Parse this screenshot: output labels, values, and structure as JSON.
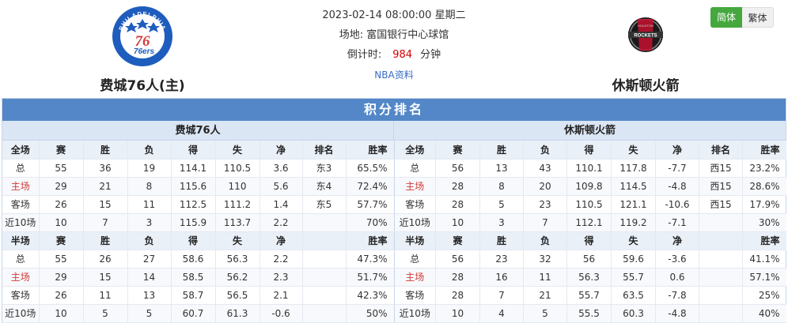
{
  "match": {
    "datetime": "2023-02-14 08:00:00",
    "weekday": "星期二",
    "venue_label": "场地:",
    "venue": "富国银行中心球馆",
    "countdown_label": "倒计时:",
    "countdown_value": "984",
    "countdown_unit": "分钟",
    "nba_link": "NBA资料"
  },
  "home_team": {
    "name": "费城76人(主)",
    "short_name": "费城76人",
    "logo_text": "76ers",
    "logo_ring_text": "PHILADELPHIA"
  },
  "away_team": {
    "name": "休斯顿火箭",
    "short_name": "休斯顿火箭",
    "logo_text": "ROCKETS",
    "logo_ring_text": "HOUSTON"
  },
  "lang": {
    "simplified": "简体",
    "traditional": "繁体"
  },
  "standings": {
    "title": "积分排名",
    "full_header": [
      "全场",
      "赛",
      "胜",
      "负",
      "得",
      "失",
      "净",
      "排名",
      "胜率"
    ],
    "half_header": [
      "半场",
      "赛",
      "胜",
      "负",
      "得",
      "失",
      "净",
      "",
      "胜率"
    ],
    "home": {
      "full": [
        [
          "总",
          "55",
          "36",
          "19",
          "114.1",
          "110.5",
          "3.6",
          "东3",
          "65.5%"
        ],
        [
          "主场",
          "29",
          "21",
          "8",
          "115.6",
          "110",
          "5.6",
          "东4",
          "72.4%"
        ],
        [
          "客场",
          "26",
          "15",
          "11",
          "112.5",
          "111.2",
          "1.4",
          "东5",
          "57.7%"
        ],
        [
          "近10场",
          "10",
          "7",
          "3",
          "115.9",
          "113.7",
          "2.2",
          "",
          "70%"
        ]
      ],
      "half": [
        [
          "总",
          "55",
          "26",
          "27",
          "58.6",
          "56.3",
          "2.2",
          "",
          "47.3%"
        ],
        [
          "主场",
          "29",
          "15",
          "14",
          "58.5",
          "56.2",
          "2.3",
          "",
          "51.7%"
        ],
        [
          "客场",
          "26",
          "11",
          "13",
          "58.7",
          "56.5",
          "2.1",
          "",
          "42.3%"
        ],
        [
          "近10场",
          "10",
          "5",
          "5",
          "60.7",
          "61.3",
          "-0.6",
          "",
          "50%"
        ]
      ]
    },
    "away": {
      "full": [
        [
          "总",
          "56",
          "13",
          "43",
          "110.1",
          "117.8",
          "-7.7",
          "西15",
          "23.2%"
        ],
        [
          "主场",
          "28",
          "8",
          "20",
          "109.8",
          "114.5",
          "-4.8",
          "西15",
          "28.6%"
        ],
        [
          "客场",
          "28",
          "5",
          "23",
          "110.5",
          "121.1",
          "-10.6",
          "西15",
          "17.9%"
        ],
        [
          "近10场",
          "10",
          "3",
          "7",
          "112.1",
          "119.2",
          "-7.1",
          "",
          "30%"
        ]
      ],
      "half": [
        [
          "总",
          "56",
          "23",
          "32",
          "56",
          "59.6",
          "-3.6",
          "",
          "41.1%"
        ],
        [
          "主场",
          "28",
          "16",
          "11",
          "56.3",
          "55.7",
          "0.6",
          "",
          "57.1%"
        ],
        [
          "客场",
          "28",
          "7",
          "21",
          "55.7",
          "63.5",
          "-7.8",
          "",
          "25%"
        ],
        [
          "近10场",
          "10",
          "4",
          "5",
          "55.5",
          "60.3",
          "-4.8",
          "",
          "40%"
        ]
      ]
    }
  },
  "colors": {
    "accent_blue": "#5387c7",
    "home_red": "#d43a3a",
    "countdown_red": "#d40000",
    "lang_active_green": "#45a83f",
    "sixers_blue": "#1e5dbd",
    "rockets_red": "#c4102e"
  }
}
